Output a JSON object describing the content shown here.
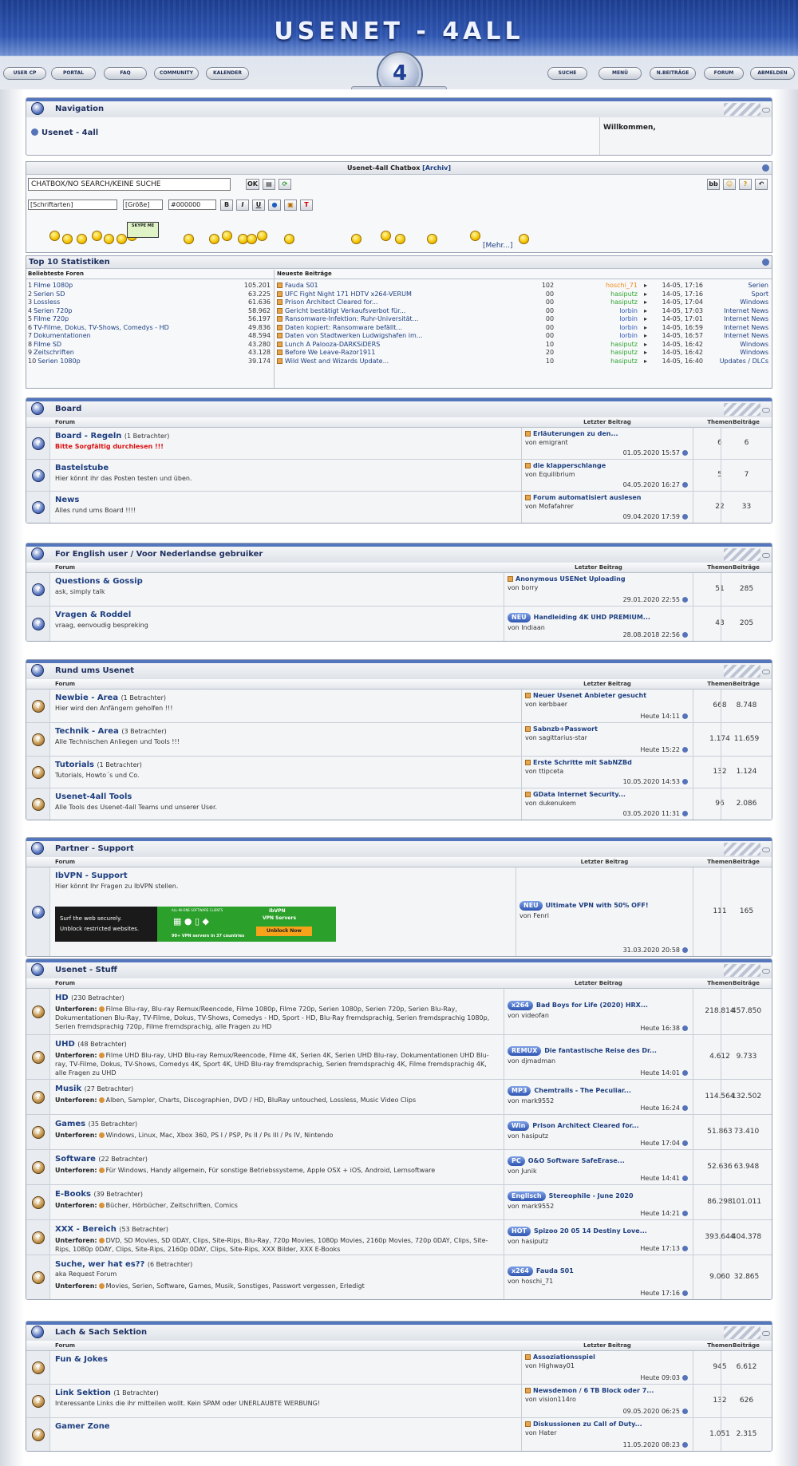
{
  "site": {
    "title": "USENET - 4ALL",
    "logo_text": "4"
  },
  "nav": {
    "left": [
      "USER CP",
      "PORTAL",
      "FAQ",
      "COMMUNITY",
      "KALENDER"
    ],
    "right": [
      "SUCHE",
      "MENÜ",
      "N.BEITRÄGE",
      "FORUM",
      "ABMELDEN"
    ]
  },
  "navigation": {
    "title": "Navigation",
    "crumb": "Usenet - 4all",
    "welcome": "Willkommen,"
  },
  "chatbox": {
    "title": "Usenet-4all Chatbox",
    "archive": "[Archiv]",
    "input": "CHATBOX/NO SEARCH/KEINE SUCHE",
    "ok": "OK",
    "font": "[Schriftarten]",
    "size": "[Größe]",
    "color": "#000000",
    "more": "[Mehr...]",
    "skype": "SKYPE ME"
  },
  "top10": {
    "title": "Top 10 Statistiken",
    "left_header": "Beliebteste Foren",
    "right_header": "Neueste Beiträge",
    "forums": [
      [
        "1",
        "Filme 1080p",
        "105.201"
      ],
      [
        "2",
        "Serien SD",
        "63.225"
      ],
      [
        "3",
        "Lossless",
        "61.636"
      ],
      [
        "4",
        "Serien 720p",
        "58.962"
      ],
      [
        "5",
        "Filme 720p",
        "56.197"
      ],
      [
        "6",
        "TV-Filme, Dokus, TV-Shows, Comedys - HD",
        "49.836"
      ],
      [
        "7",
        "Dokumentationen",
        "48.594"
      ],
      [
        "8",
        "Filme SD",
        "43.280"
      ],
      [
        "9",
        "Zeitschriften",
        "43.128"
      ],
      [
        "10",
        "Serien 1080p",
        "39.174"
      ]
    ],
    "posts": [
      [
        "Fauda S01",
        "10",
        "2",
        "hoschi_71",
        "14-05, 17:16",
        "Serien",
        "o"
      ],
      [
        "UFC Fight Night 171 HDTV x264-VERUM",
        "0",
        "0",
        "hasiputz",
        "14-05, 17:16",
        "Sport",
        "g"
      ],
      [
        "Prison Architect Cleared for...",
        "0",
        "0",
        "hasiputz",
        "14-05, 17:04",
        "Windows",
        "g"
      ],
      [
        "Gericht bestätigt Verkaufsverbot für...",
        "0",
        "0",
        "lorbin",
        "14-05, 17:03",
        "Internet News",
        "b"
      ],
      [
        "Ransomware-Infektion: Ruhr-Universität...",
        "0",
        "0",
        "lorbin",
        "14-05, 17:01",
        "Internet News",
        "b"
      ],
      [
        "Daten kopiert: Ransomware befällt...",
        "0",
        "0",
        "lorbin",
        "14-05, 16:59",
        "Internet News",
        "b"
      ],
      [
        "Daten von Stadtwerken Ludwigshafen im...",
        "0",
        "0",
        "lorbin",
        "14-05, 16:57",
        "Internet News",
        "b"
      ],
      [
        "Lunch A Palooza-DARKSiDERS",
        "1",
        "0",
        "hasiputz",
        "14-05, 16:42",
        "Windows",
        "g"
      ],
      [
        "Before We Leave-Razor1911",
        "2",
        "0",
        "hasiputz",
        "14-05, 16:42",
        "Windows",
        "g"
      ],
      [
        "Wild West and Wizards Update...",
        "1",
        "0",
        "hasiputz",
        "14-05, 16:40",
        "Updates / DLCs",
        "g"
      ]
    ]
  },
  "headers": {
    "forum": "Forum",
    "last": "Letzter Beitrag",
    "themen": "Themen",
    "beitraege": "Beiträge",
    "unterforen": "Unterforen:"
  },
  "sections": [
    {
      "title": "Board",
      "rows": [
        {
          "name": "Board - Regeln",
          "viewers": "(1 Betrachter)",
          "desc": "Bitte Sorgfältig durchlesen !!!",
          "warn": true,
          "lt": "Erläuterungen zu den...",
          "by": "von emigrant",
          "date": "01.05.2020 15:57",
          "t": "6",
          "b": "6"
        },
        {
          "name": "Bastelstube",
          "viewers": "",
          "desc": "Hier könnt ihr das Posten testen und üben.",
          "lt": "die klapperschlange",
          "by": "von Equilibrium",
          "date": "04.05.2020 16:27",
          "t": "5",
          "b": "7"
        },
        {
          "name": "News",
          "viewers": "",
          "desc": "Alles rund ums Board !!!!",
          "lt": "Forum automatisiert auslesen",
          "by": "von Mofafahrer",
          "date": "09.04.2020 17:59",
          "t": "22",
          "b": "33"
        }
      ]
    },
    {
      "title": "For English user / Voor Nederlandse gebruiker",
      "rows": [
        {
          "name": "Questions & Gossip",
          "viewers": "",
          "desc": "ask, simply talk",
          "lt": "Anonymous USENet Uploading",
          "by": "von borry",
          "date": "29.01.2020 22:55",
          "t": "51",
          "b": "285"
        },
        {
          "name": "Vragen & Roddel",
          "viewers": "",
          "desc": "vraag, eenvoudig bespreking",
          "tag": "NEU",
          "lt": "Handleiding 4K UHD PREMIUM...",
          "by": "von Indiaan",
          "date": "28.08.2018 22:56",
          "t": "43",
          "b": "205"
        }
      ]
    },
    {
      "title": "Rund ums Usenet",
      "rows": [
        {
          "name": "Newbie - Area",
          "viewers": "(1 Betrachter)",
          "desc": "Hier wird den Anfängern geholfen !!!",
          "lt": "Neuer Usenet Anbieter gesucht",
          "by": "von kerbbaer",
          "date": "Heute 14:11",
          "t": "668",
          "b": "8.748"
        },
        {
          "name": "Technik - Area",
          "viewers": "(3 Betrachter)",
          "desc": "Alle Technischen Anliegen und Tools !!!",
          "lt": "Sabnzb+Passwort",
          "by": "von sagittarius-star",
          "date": "Heute 15:22",
          "t": "1.174",
          "b": "11.659"
        },
        {
          "name": "Tutorials",
          "viewers": "(1 Betrachter)",
          "desc": "Tutorials, Howto´s und Co.",
          "lt": "Erste Schritte mit SabNZBd",
          "by": "von ttipceta",
          "date": "10.05.2020 14:53",
          "t": "132",
          "b": "1.124"
        },
        {
          "name": "Usenet-4all Tools",
          "viewers": "",
          "desc": "Alle Tools des Usenet-4all Teams und unserer User.",
          "lt": "GData Internet Security...",
          "by": "von dukenukem",
          "date": "03.05.2020 11:31",
          "t": "96",
          "b": "2.086"
        }
      ]
    },
    {
      "title": "Partner - Support",
      "rows": [
        {
          "name": "IbVPN - Support",
          "viewers": "",
          "desc": "Hier könnt Ihr Fragen zu IbVPN stellen.",
          "tag": "NEU",
          "lt": "Ultimate VPN with 50% OFF!",
          "by": "von Fenri",
          "date": "31.03.2020 20:58",
          "t": "111",
          "b": "165"
        }
      ]
    },
    {
      "title": "Usenet - Stuff",
      "rows": [
        {
          "name": "HD",
          "viewers": "(230 Betrachter)",
          "subs": "Filme Blu-ray, Blu-ray Remux/Reencode, Filme 1080p, Filme 720p, Serien 1080p, Serien 720p, Serien Blu-Ray, Dokumentationen Blu-Ray, TV-Filme, Dokus, TV-Shows, Comedys - HD, Sport - HD, Blu-Ray fremdsprachig, Serien fremdsprachig 1080p, Serien fremdsprachig 720p, Filme fremdsprachig, alle Fragen zu HD",
          "tag": "x264",
          "lt": "Bad Boys for Life (2020) HRX...",
          "by": "von videofan",
          "date": "Heute 16:38",
          "t": "218.814",
          "b": "457.850"
        },
        {
          "name": "UHD",
          "viewers": "(48 Betrachter)",
          "subs": "Filme UHD Blu-ray, UHD Blu-ray Remux/Reencode, Filme 4K, Serien 4K, Serien UHD Blu-ray, Dokumentationen UHD Blu-ray, TV-Filme, Dokus, TV-Shows, Comedys 4K, Sport 4K, UHD Blu-ray fremdsprachig, Serien fremdsprachig 4K, Filme fremdsprachig 4K, alle Fragen zu UHD",
          "tag": "REMUX",
          "lt": "Die fantastische Reise des Dr...",
          "by": "von djmadman",
          "date": "Heute 14:01",
          "t": "4.612",
          "b": "9.733"
        },
        {
          "name": "Musik",
          "viewers": "(27 Betrachter)",
          "subs": "Alben, Sampler, Charts, Discographien, DVD / HD, BluRay untouched, Lossless, Music Video Clips",
          "tag": "MP3",
          "lt": "Chemtrails - The Peculiar...",
          "by": "von mark9552",
          "date": "Heute 16:24",
          "t": "114.564",
          "b": "132.502"
        },
        {
          "name": "Games",
          "viewers": "(35 Betrachter)",
          "subs": "Windows, Linux, Mac, Xbox 360, PS I / PSP, Ps II / Ps III / Ps IV, Nintendo",
          "tag": "Win",
          "lt": "Prison Architect Cleared for...",
          "by": "von hasiputz",
          "date": "Heute 17:04",
          "t": "51.863",
          "b": "73.410"
        },
        {
          "name": "Software",
          "viewers": "(22 Betrachter)",
          "subs": "Für Windows, Handy allgemein, Für sonstige Betriebssysteme, Apple OSX + iOS, Android, Lernsoftware",
          "tag": "PC",
          "lt": "O&O Software SafeErase...",
          "by": "von Junik",
          "date": "Heute 14:41",
          "t": "52.636",
          "b": "63.948"
        },
        {
          "name": "E-Books",
          "viewers": "(39 Betrachter)",
          "subs": "Bücher, Hörbücher, Zeitschriften, Comics",
          "tag": "Englisch",
          "lt": "Stereophile - June 2020",
          "by": "von mark9552",
          "date": "Heute 14:21",
          "t": "86.298",
          "b": "101.011"
        },
        {
          "name": "XXX - Bereich",
          "viewers": "(53 Betrachter)",
          "subs": "DVD, SD Movies, SD 0DAY, Clips, Site-Rips, Blu-Ray, 720p Movies, 1080p Movies, 2160p Movies, 720p 0DAY, Clips, Site-Rips, 1080p 0DAY, Clips, Site-Rips, 2160p 0DAY, Clips, Site-Rips, XXX Bilder, XXX E-Books",
          "tag": "HOT",
          "lt": "Spizoo 20 05 14 Destiny Love...",
          "by": "von hasiputz",
          "date": "Heute 17:13",
          "t": "393.644",
          "b": "404.378"
        },
        {
          "name": "Suche, wer hat es??",
          "viewers": "(6 Betrachter)",
          "desc": "aka Request Forum",
          "subs": "Movies, Serien, Software, Games, Musik, Sonstiges, Passwort vergessen, Erledigt",
          "tag": "x264",
          "lt": "Fauda S01",
          "by": "von hoschi_71",
          "date": "Heute 17:16",
          "t": "9.060",
          "b": "32.865"
        }
      ]
    },
    {
      "title": "Lach & Sach Sektion",
      "rows": [
        {
          "name": "Fun & Jokes",
          "viewers": "",
          "desc": "",
          "lt": "Assoziationsspiel",
          "by": "von Highway01",
          "date": "Heute 09:03",
          "t": "945",
          "b": "6.612"
        },
        {
          "name": "Link Sektion",
          "viewers": "(1 Betrachter)",
          "desc": "Interessante Links die ihr mitteilen wollt. Kein SPAM oder UNERLAUBTE WERBUNG!",
          "lt": "Newsdemon / 6 TB Block oder 7...",
          "by": "von vision114ro",
          "date": "09.05.2020 06:25",
          "t": "132",
          "b": "626"
        },
        {
          "name": "Gamer Zone",
          "viewers": "",
          "desc": "",
          "lt": "Diskussionen zu Call of Duty...",
          "by": "von Hater",
          "date": "11.05.2020 08:23",
          "t": "1.051",
          "b": "2.315"
        }
      ]
    }
  ],
  "banner": {
    "l1": "Surf the web securely.",
    "l2": "Unblock restricted websites.",
    "r0": "ALL-IN-ONE SOFTWARE CLIENTS",
    "r1": "IbVPN",
    "r2": "VPN Servers",
    "r3": "90+ VPN servers in 37 countries",
    "r4": "Unblock Now"
  }
}
